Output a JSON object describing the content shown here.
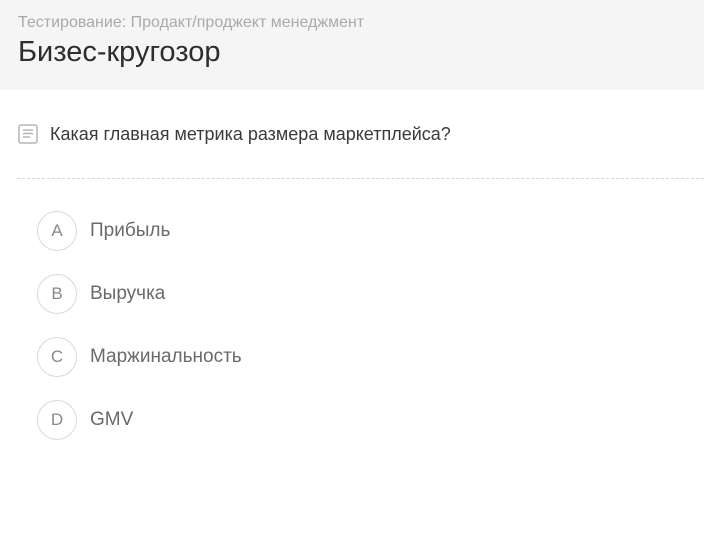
{
  "header": {
    "breadcrumb": "Тестирование: Продакт/проджект менеджмент",
    "title": "Бизес-кругозор"
  },
  "question": {
    "icon": "document-icon",
    "text": "Какая главная метрика размера маркетплейса?"
  },
  "options": [
    {
      "letter": "A",
      "text": "Прибыль"
    },
    {
      "letter": "B",
      "text": "Выручка"
    },
    {
      "letter": "C",
      "text": "Маржинальность"
    },
    {
      "letter": "D",
      "text": "GMV"
    }
  ],
  "colors": {
    "header_bg": "#f5f5f5",
    "breadcrumb": "#aaaaaa",
    "title": "#2d2d2d",
    "option_border": "#d9d9d9"
  }
}
